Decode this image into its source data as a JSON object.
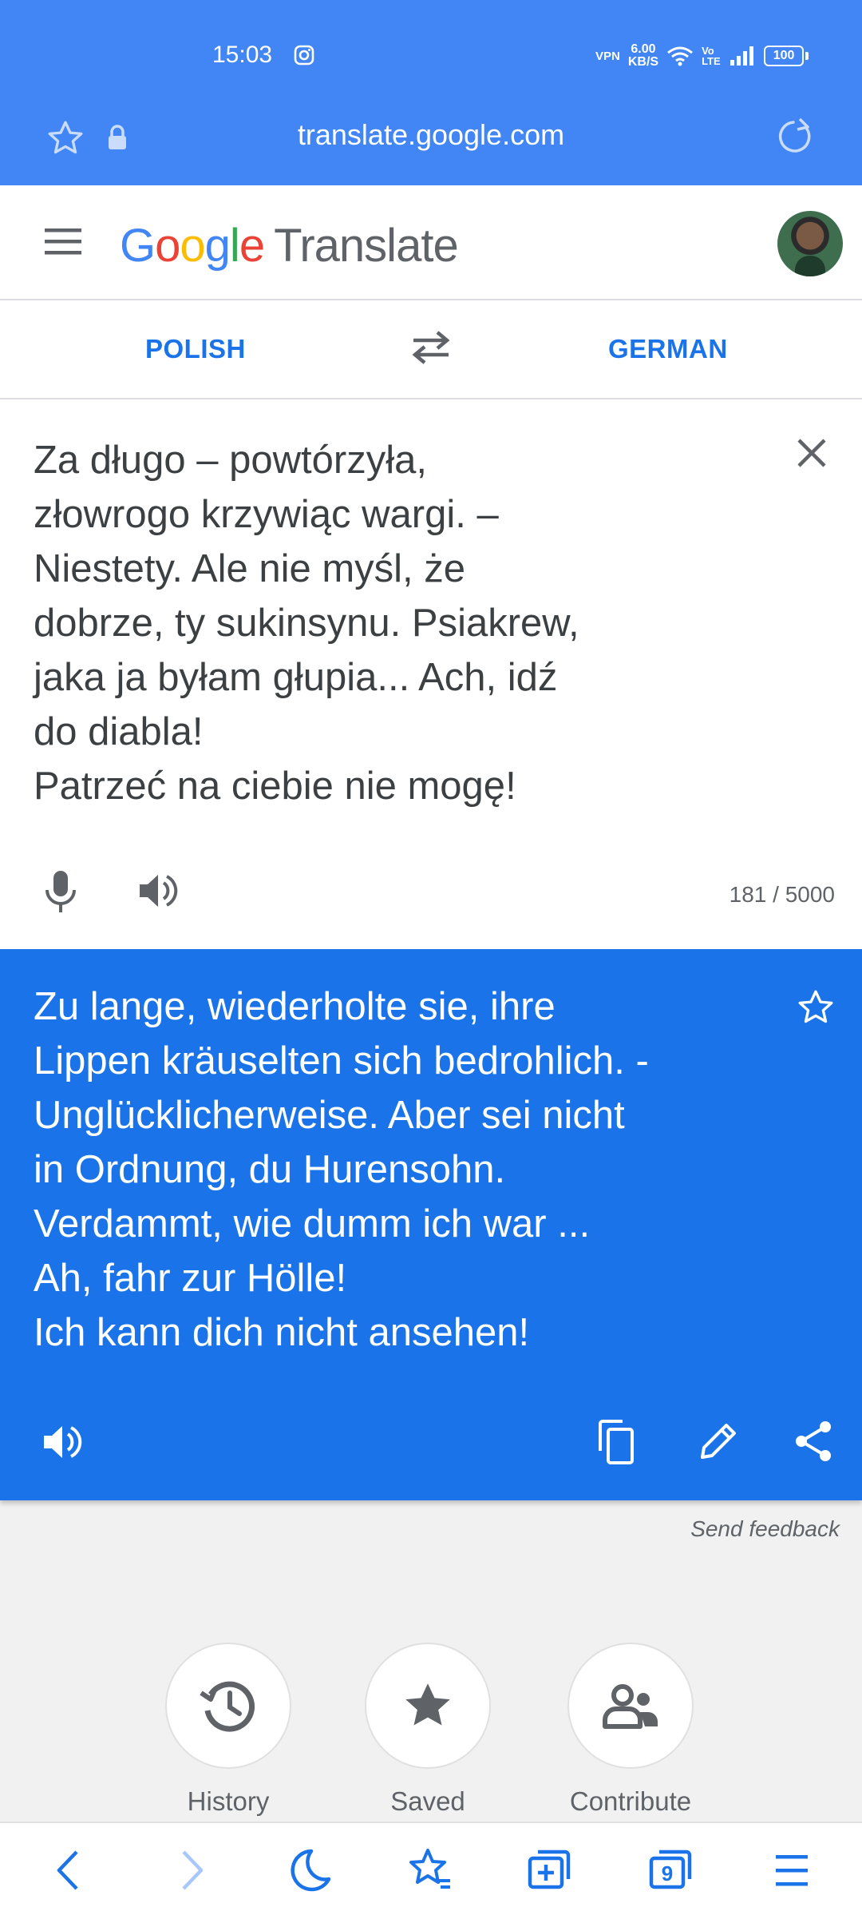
{
  "status_bar": {
    "time": "15:03",
    "network_speed_value": "6.00",
    "network_speed_unit": "KB/S",
    "vpn_label": "VPN",
    "volte_label": "Vo LTE",
    "battery": "100"
  },
  "address_bar": {
    "url": "translate.google.com"
  },
  "app_header": {
    "logo_letters": [
      "G",
      "o",
      "o",
      "g",
      "l",
      "e"
    ],
    "product_name": "Translate"
  },
  "language_bar": {
    "source_language": "POLISH",
    "target_language": "GERMAN"
  },
  "source_panel": {
    "text": "Za długo – powtórzyła,\nzłowrogo krzywiąc wargi. –\nNiestety. Ale nie myśl, że\ndobrze, ty sukinsynu. Psiakrew,\njaka ja byłam głupia... Ach, idź\ndo diabla!\nPatrzeć na ciebie nie mogę!",
    "char_count": "181 / 5000"
  },
  "translation_panel": {
    "text": "Zu lange, wiederholte sie, ihre\nLippen kräuselten sich bedrohlich. -\nUnglücklicherweise. Aber sei nicht\nin Ordnung, du Hurensohn.\nVerdammt, wie dumm ich war ...\nAh, fahr zur Hölle!\nIch kann dich nicht ansehen!"
  },
  "send_feedback": "Send feedback",
  "shortcuts": [
    {
      "label": "History",
      "icon": "history-icon"
    },
    {
      "label": "Saved",
      "icon": "star-filled-icon"
    },
    {
      "label": "Contribute",
      "icon": "people-icon"
    }
  ],
  "browser_nav": {
    "icons": [
      "back-icon",
      "forward-icon",
      "night-mode-icon",
      "bookmarks-icon",
      "new-tab-icon",
      "tab-switcher-icon",
      "menu-icon"
    ],
    "tab_count": "9"
  },
  "colors": {
    "chrome_blue": "#4285f4",
    "translate_blue": "#1a73e8",
    "background": "#f1f1f1"
  }
}
